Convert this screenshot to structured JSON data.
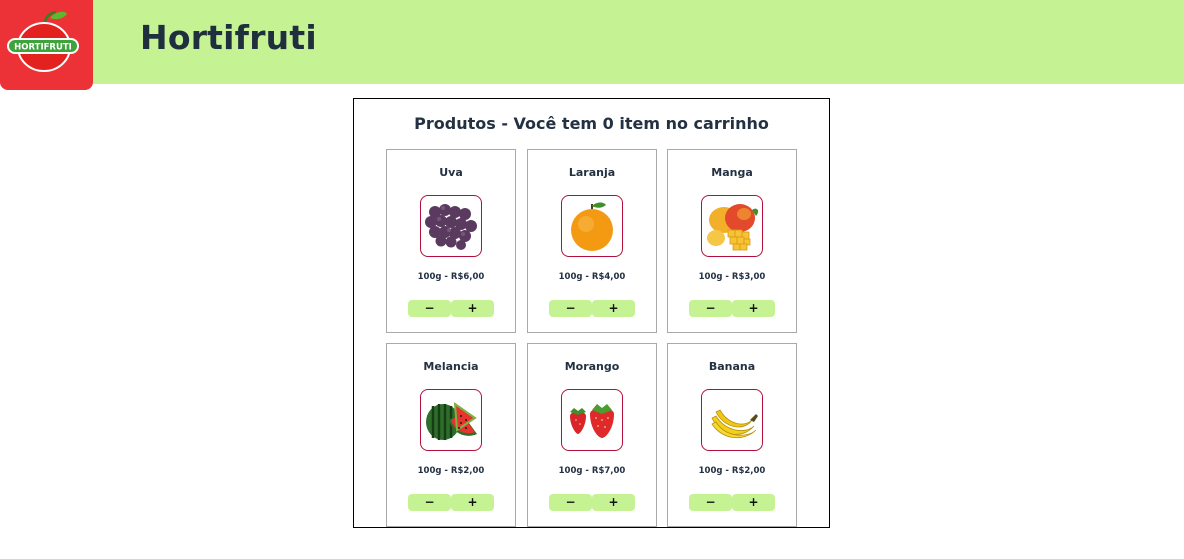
{
  "header": {
    "logo_text": "HORTIFRUTI",
    "title": "Hortifruti",
    "brand_colors": {
      "bar": "#c5f394",
      "logo": "#ed3237"
    }
  },
  "products_panel": {
    "title": "Produtos - Você tem 0 item no carrinho",
    "minus_label": "−",
    "plus_label": "+",
    "items": [
      {
        "name": "Uva",
        "price": "100g - R$6,00",
        "icon": "grapes-image"
      },
      {
        "name": "Laranja",
        "price": "100g - R$4,00",
        "icon": "orange-image"
      },
      {
        "name": "Manga",
        "price": "100g - R$3,00",
        "icon": "mango-image"
      },
      {
        "name": "Melancia",
        "price": "100g - R$2,00",
        "icon": "watermelon-image"
      },
      {
        "name": "Morango",
        "price": "100g - R$7,00",
        "icon": "strawberry-image"
      },
      {
        "name": "Banana",
        "price": "100g - R$2,00",
        "icon": "banana-image"
      }
    ]
  }
}
